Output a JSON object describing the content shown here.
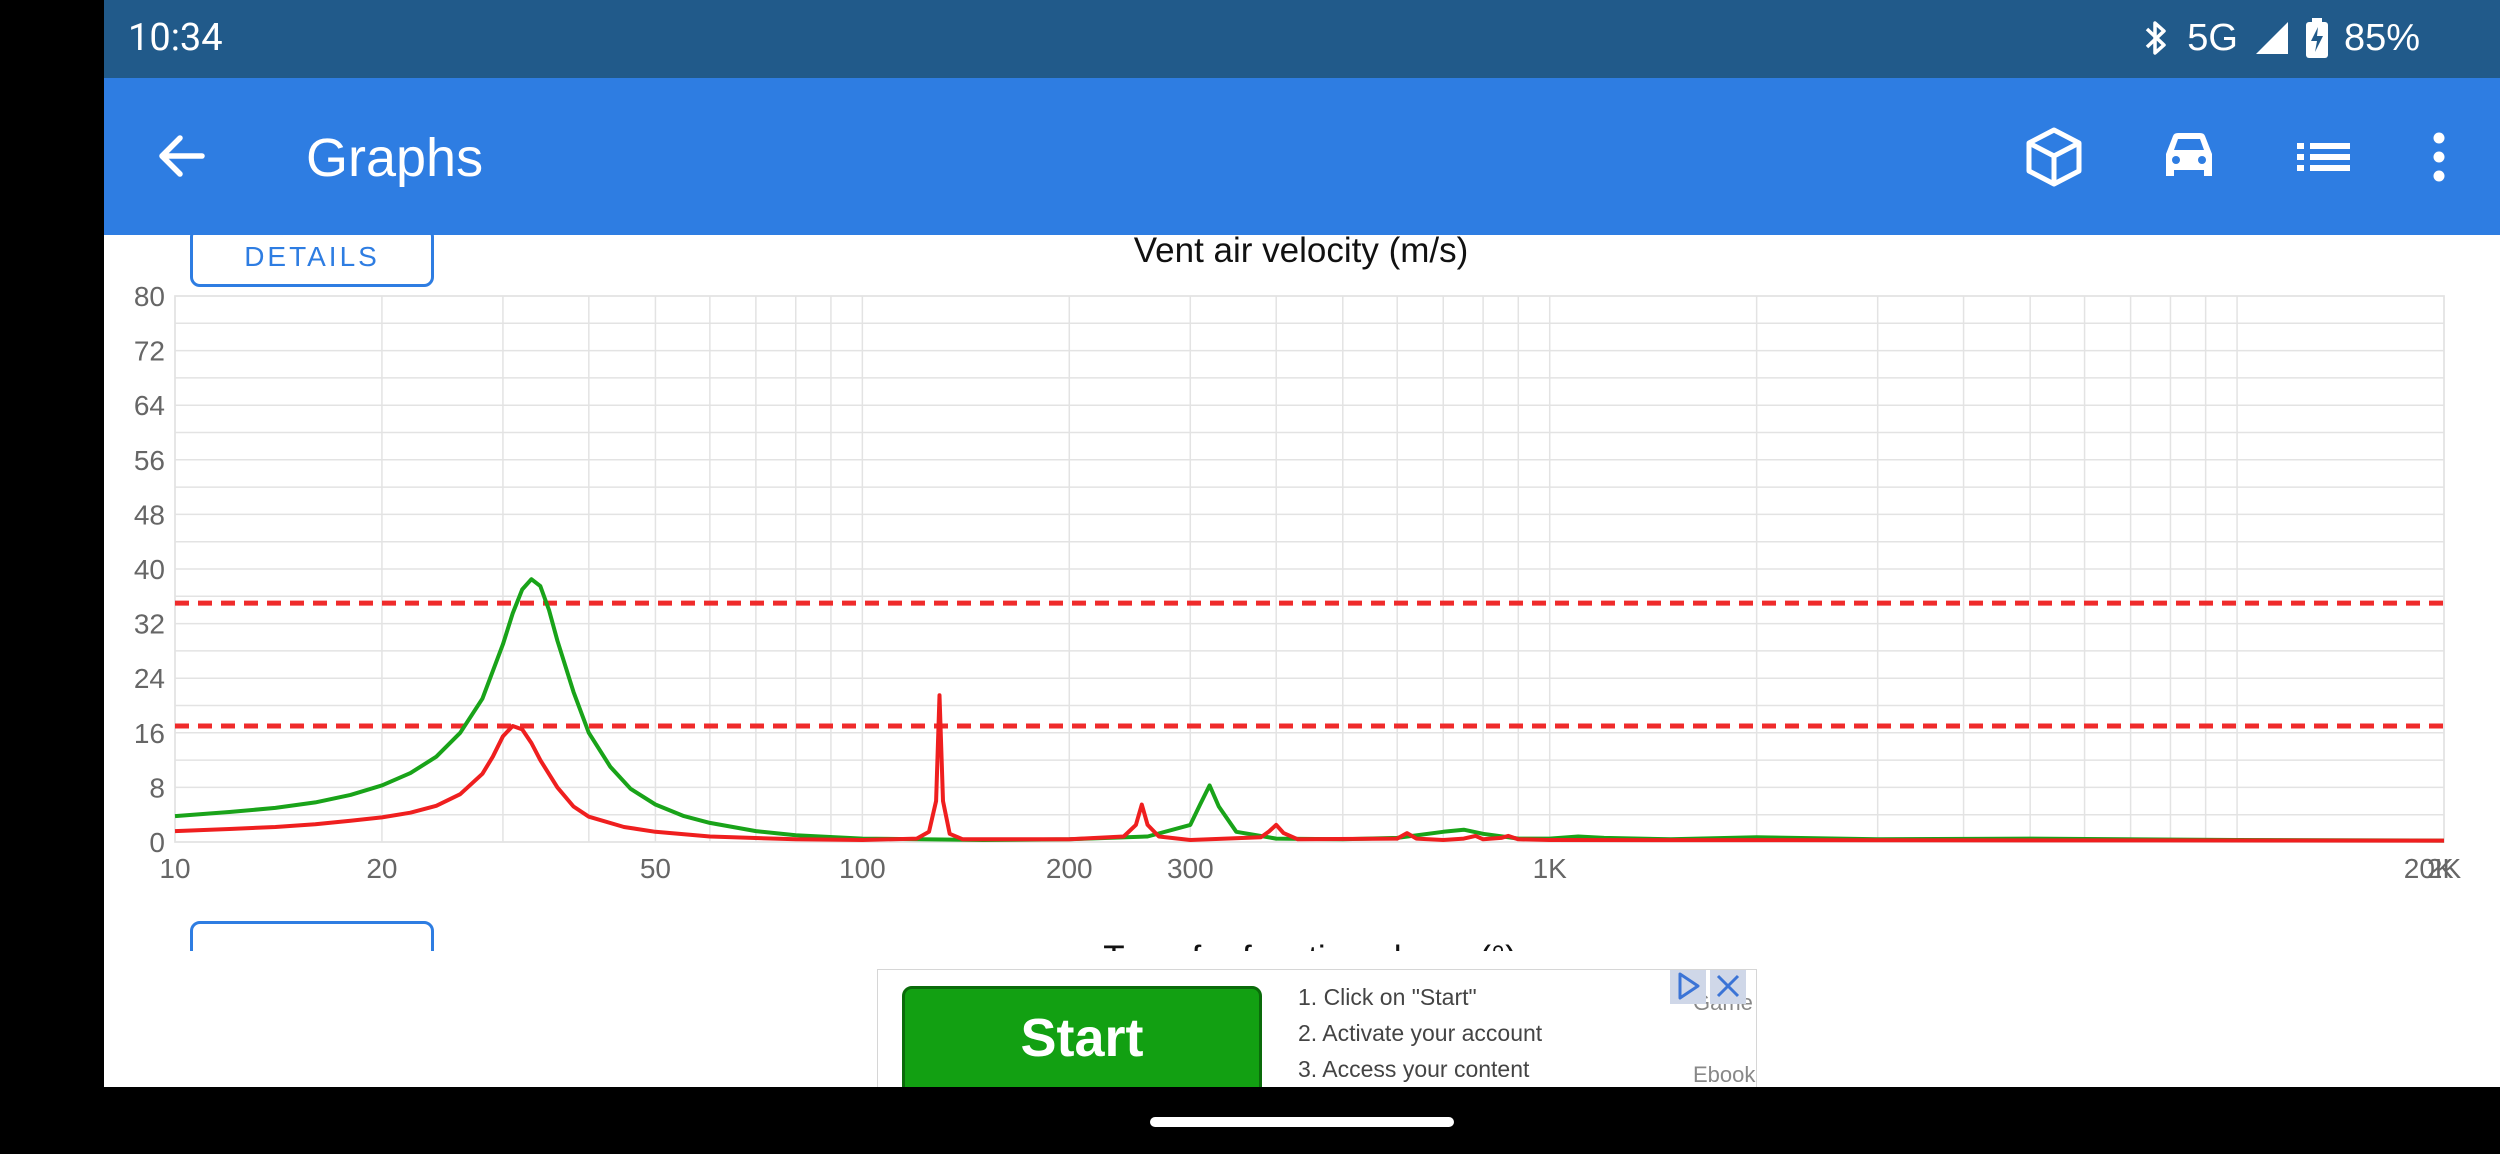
{
  "status_bar": {
    "time": "10:34",
    "network": "5G",
    "battery": "85%",
    "icons": [
      "bluetooth-icon",
      "signal-icon",
      "battery-charging-icon"
    ]
  },
  "app_bar": {
    "title": "Graphs",
    "back_icon": "arrow-left-icon",
    "action_icons": [
      "cube-icon",
      "car-icon",
      "list-icon",
      "more-vert-icon"
    ]
  },
  "details_button": {
    "label": "DETAILS"
  },
  "chart_data": {
    "type": "line",
    "title": "Vent air velocity (m/s)",
    "xlabel": "",
    "ylabel": "",
    "x_scale": "log",
    "xlim": [
      10,
      20000
    ],
    "ylim": [
      0,
      80
    ],
    "grid": true,
    "legend": "none",
    "x_tick_labels": [
      {
        "value": 10,
        "label": "10"
      },
      {
        "value": 20,
        "label": "20"
      },
      {
        "value": 50,
        "label": "50"
      },
      {
        "value": 100,
        "label": "100"
      },
      {
        "value": 200,
        "label": "200"
      },
      {
        "value": 300,
        "label": "300"
      },
      {
        "value": 1000,
        "label": "1K"
      },
      {
        "value": 19000,
        "label": "20K"
      },
      {
        "value": 20000,
        "label": "2K"
      }
    ],
    "y_ticks": [
      0,
      8,
      16,
      24,
      32,
      40,
      48,
      56,
      64,
      72,
      80
    ],
    "reference_lines": [
      {
        "y": 35,
        "color": "#ef2b2b",
        "style": "dashed"
      },
      {
        "y": 17,
        "color": "#ef2b2b",
        "style": "dashed"
      }
    ],
    "series": [
      {
        "color": "#19a319",
        "points": [
          [
            10,
            3.8
          ],
          [
            12,
            4.4
          ],
          [
            14,
            5
          ],
          [
            16,
            5.8
          ],
          [
            18,
            6.9
          ],
          [
            20,
            8.3
          ],
          [
            22,
            10.1
          ],
          [
            24,
            12.5
          ],
          [
            26,
            16
          ],
          [
            28,
            21
          ],
          [
            30,
            29
          ],
          [
            31,
            33.5
          ],
          [
            32,
            37
          ],
          [
            33,
            38.5
          ],
          [
            34,
            37.5
          ],
          [
            35,
            34
          ],
          [
            36,
            29.5
          ],
          [
            38,
            22
          ],
          [
            40,
            16
          ],
          [
            43,
            11
          ],
          [
            46,
            7.8
          ],
          [
            50,
            5.5
          ],
          [
            55,
            3.8
          ],
          [
            60,
            2.8
          ],
          [
            70,
            1.6
          ],
          [
            80,
            1
          ],
          [
            100,
            0.5
          ],
          [
            150,
            0.3
          ],
          [
            200,
            0.4
          ],
          [
            260,
            0.8
          ],
          [
            300,
            2.5
          ],
          [
            310,
            5.5
          ],
          [
            320,
            8.3
          ],
          [
            330,
            5.2
          ],
          [
            350,
            1.5
          ],
          [
            400,
            0.5
          ],
          [
            500,
            0.4
          ],
          [
            600,
            0.6
          ],
          [
            700,
            1.5
          ],
          [
            750,
            1.8
          ],
          [
            800,
            1.2
          ],
          [
            900,
            0.5
          ],
          [
            1000,
            0.5
          ],
          [
            1100,
            0.8
          ],
          [
            1200,
            0.6
          ],
          [
            1500,
            0.4
          ],
          [
            2000,
            0.7
          ],
          [
            3000,
            0.4
          ],
          [
            5000,
            0.5
          ],
          [
            10000,
            0.3
          ],
          [
            20000,
            0.2
          ]
        ]
      },
      {
        "color": "#ef1f1f",
        "points": [
          [
            10,
            1.6
          ],
          [
            12,
            1.9
          ],
          [
            14,
            2.2
          ],
          [
            16,
            2.6
          ],
          [
            18,
            3.1
          ],
          [
            20,
            3.6
          ],
          [
            22,
            4.3
          ],
          [
            24,
            5.3
          ],
          [
            26,
            7
          ],
          [
            28,
            10
          ],
          [
            29,
            12.5
          ],
          [
            30,
            15.5
          ],
          [
            31,
            17
          ],
          [
            32,
            16.5
          ],
          [
            33,
            14.5
          ],
          [
            34,
            12
          ],
          [
            36,
            8
          ],
          [
            38,
            5.2
          ],
          [
            40,
            3.7
          ],
          [
            45,
            2.2
          ],
          [
            50,
            1.5
          ],
          [
            60,
            0.8
          ],
          [
            80,
            0.4
          ],
          [
            100,
            0.3
          ],
          [
            120,
            0.5
          ],
          [
            125,
            1.5
          ],
          [
            128,
            6
          ],
          [
            129.5,
            21.5
          ],
          [
            131,
            6
          ],
          [
            134,
            1.2
          ],
          [
            140,
            0.4
          ],
          [
            200,
            0.4
          ],
          [
            240,
            0.8
          ],
          [
            250,
            2.5
          ],
          [
            255,
            5.5
          ],
          [
            260,
            2.5
          ],
          [
            270,
            0.8
          ],
          [
            300,
            0.3
          ],
          [
            380,
            0.7
          ],
          [
            390,
            1.5
          ],
          [
            400,
            2.5
          ],
          [
            410,
            1.3
          ],
          [
            430,
            0.4
          ],
          [
            600,
            0.5
          ],
          [
            620,
            1.3
          ],
          [
            640,
            0.5
          ],
          [
            700,
            0.3
          ],
          [
            750,
            0.5
          ],
          [
            780,
            0.9
          ],
          [
            800,
            0.4
          ],
          [
            850,
            0.6
          ],
          [
            870,
            0.9
          ],
          [
            900,
            0.4
          ],
          [
            1000,
            0.3
          ],
          [
            20000,
            0.2
          ]
        ]
      }
    ]
  },
  "next_chart_title": "Transfer function phase (°)",
  "ad": {
    "start_label": "Start",
    "steps": [
      "1. Click on \"Start\"",
      "2. Activate your account",
      "3. Access your content"
    ],
    "side_labels": [
      "Game",
      "Ebook"
    ]
  }
}
